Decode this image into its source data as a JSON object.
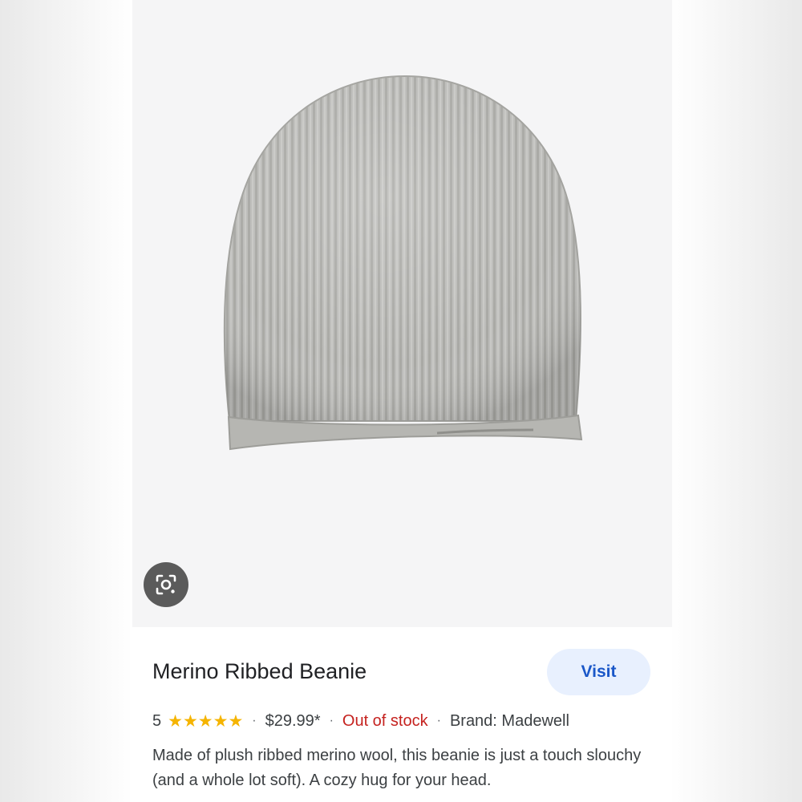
{
  "product": {
    "title": "Merino Ribbed Beanie",
    "rating": "5",
    "star_count": 5,
    "price": "$29.99*",
    "stock_status": "Out of stock",
    "brand": "Brand: Madewell",
    "description": "Made of plush ribbed merino wool, this beanie is just a touch slouchy (and a whole lot soft). A cozy hug for your head."
  },
  "actions": {
    "visit_label": "Visit"
  },
  "image": {
    "lens_icon": "lens-search-icon",
    "subject": "product-photo"
  },
  "colors": {
    "accent": "#1a57c8",
    "visit_bg": "#e8f0fe",
    "star": "#f5b400",
    "out_of_stock": "#c5221f",
    "image_bg": "#f5f5f6",
    "beanie": "#bebebb"
  }
}
